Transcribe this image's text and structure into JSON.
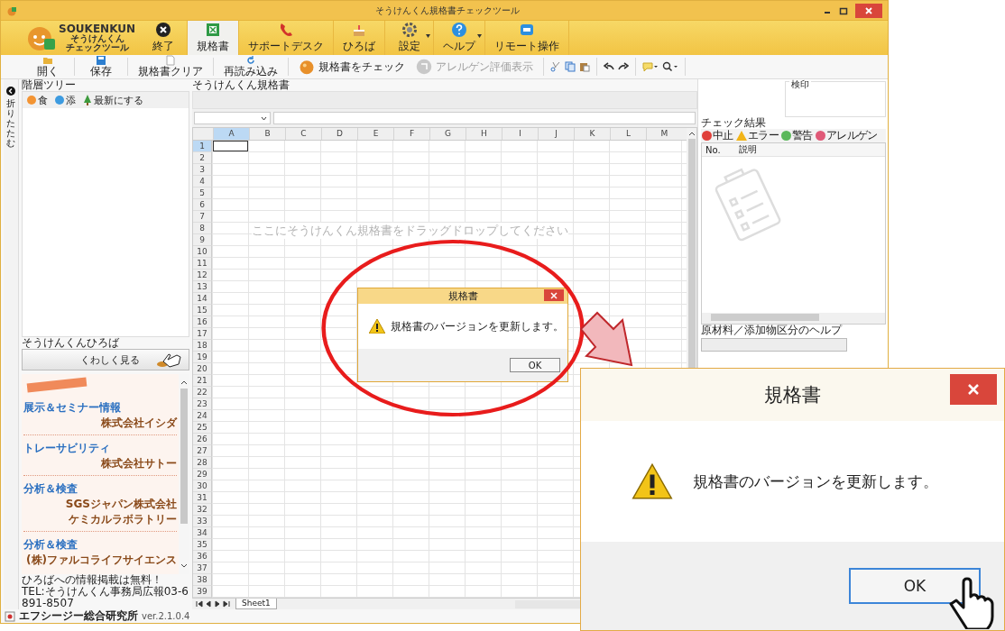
{
  "window": {
    "title": "そうけんくん規格書チェックツール"
  },
  "logo": {
    "name": "SOUKENKUN",
    "subtitle": "そうけんくん",
    "tagline": "チェックツール"
  },
  "ribbon_tabs": [
    {
      "label": "終了",
      "selected": false,
      "dropdown": false
    },
    {
      "label": "規格書",
      "selected": true,
      "dropdown": false
    },
    {
      "label": "サポートデスク",
      "selected": false,
      "dropdown": false
    },
    {
      "label": "ひろば",
      "selected": false,
      "dropdown": false
    },
    {
      "label": "設定",
      "selected": false,
      "dropdown": true
    },
    {
      "label": "ヘルプ",
      "selected": false,
      "dropdown": true
    },
    {
      "label": "リモート操作",
      "selected": false,
      "dropdown": false
    }
  ],
  "toolbar": [
    {
      "label": "開く",
      "kind": "stacked",
      "disabled": false
    },
    {
      "label": "保存",
      "kind": "stacked",
      "disabled": false
    },
    {
      "label": "規格書クリア",
      "kind": "stacked",
      "disabled": false
    },
    {
      "label": "再読み込み",
      "kind": "stacked",
      "disabled": false
    },
    {
      "label": "規格書をチェック",
      "kind": "inline",
      "disabled": false
    },
    {
      "label": "アレルゲン評価表示",
      "kind": "inline",
      "disabled": true
    }
  ],
  "left_panel": {
    "collapse_label": "折りたたむ",
    "title": "階層ツリー",
    "filters": [
      {
        "label": "食",
        "color": "#f39433"
      },
      {
        "label": "添",
        "color": "#3d9be0"
      }
    ],
    "refresh_label": "最新にする"
  },
  "hiroba": {
    "title": "そうけんくんひろば",
    "more_button": "くわしく見る",
    "entries": [
      {
        "category": "展示＆セミナー情報",
        "company": [
          "株式会社イシダ"
        ]
      },
      {
        "category": "トレーサビリティ",
        "company": [
          "株式会社サトー"
        ]
      },
      {
        "category": "分析＆検査",
        "company": [
          "SGSジャパン株式会社",
          "ケミカルラボラトリー"
        ]
      },
      {
        "category": "分析＆検査",
        "company": [
          "(株)ファルコライフサイエンス"
        ]
      }
    ],
    "footer": [
      "ひろばへの情報掲載は無料！",
      "TEL:そうけんくん事務局広報03-6891-8507"
    ]
  },
  "editor": {
    "title": "そうけんくん規格書",
    "columns": [
      {
        "label": "A",
        "selected": true
      },
      {
        "label": "B",
        "selected": false
      },
      {
        "label": "C",
        "selected": false
      },
      {
        "label": "D",
        "selected": false
      },
      {
        "label": "E",
        "selected": false
      },
      {
        "label": "F",
        "selected": false
      },
      {
        "label": "G",
        "selected": false
      },
      {
        "label": "H",
        "selected": false
      },
      {
        "label": "I",
        "selected": false
      },
      {
        "label": "J",
        "selected": false
      },
      {
        "label": "K",
        "selected": false
      },
      {
        "label": "L",
        "selected": false
      },
      {
        "label": "M",
        "selected": false
      }
    ],
    "rows": [
      {
        "label": "1",
        "selected": true
      },
      {
        "label": "2",
        "selected": false
      },
      {
        "label": "3",
        "selected": false
      },
      {
        "label": "4",
        "selected": false
      },
      {
        "label": "5",
        "selected": false
      },
      {
        "label": "6",
        "selected": false
      },
      {
        "label": "7",
        "selected": false
      },
      {
        "label": "8",
        "selected": false
      },
      {
        "label": "9",
        "selected": false
      },
      {
        "label": "10",
        "selected": false
      },
      {
        "label": "11",
        "selected": false
      },
      {
        "label": "12",
        "selected": false
      },
      {
        "label": "13",
        "selected": false
      },
      {
        "label": "14",
        "selected": false
      },
      {
        "label": "15",
        "selected": false
      },
      {
        "label": "16",
        "selected": false
      },
      {
        "label": "17",
        "selected": false
      },
      {
        "label": "18",
        "selected": false
      },
      {
        "label": "19",
        "selected": false
      },
      {
        "label": "20",
        "selected": false
      },
      {
        "label": "21",
        "selected": false
      },
      {
        "label": "22",
        "selected": false
      },
      {
        "label": "23",
        "selected": false
      },
      {
        "label": "24",
        "selected": false
      },
      {
        "label": "25",
        "selected": false
      },
      {
        "label": "26",
        "selected": false
      },
      {
        "label": "27",
        "selected": false
      },
      {
        "label": "28",
        "selected": false
      },
      {
        "label": "29",
        "selected": false
      },
      {
        "label": "30",
        "selected": false
      },
      {
        "label": "31",
        "selected": false
      },
      {
        "label": "32",
        "selected": false
      },
      {
        "label": "33",
        "selected": false
      },
      {
        "label": "34",
        "selected": false
      },
      {
        "label": "35",
        "selected": false
      },
      {
        "label": "36",
        "selected": false
      },
      {
        "label": "37",
        "selected": false
      },
      {
        "label": "38",
        "selected": false
      },
      {
        "label": "39",
        "selected": false
      }
    ],
    "drop_hint": "ここにそうけんくん規格書をドラッグドロップしてください",
    "sheet_tabs": [
      {
        "label": "Sheet1",
        "selected": true
      }
    ]
  },
  "right_panel": {
    "stamp_title": "検印",
    "results_title": "チェック結果",
    "result_filters": [
      {
        "label": "中止",
        "kind": "circle",
        "color": "#e0403a"
      },
      {
        "label": "エラー",
        "kind": "triangle",
        "color": "#f2b418"
      },
      {
        "label": "警告",
        "kind": "circle",
        "color": "#5cb85c"
      },
      {
        "label": "アレルゲン",
        "kind": "circle",
        "color": "#e05a78"
      }
    ],
    "result_columns": [
      "No.",
      "説明"
    ],
    "help_title": "原材料／添加物区分のヘルプ"
  },
  "dialog": {
    "title": "規格書",
    "message": "規格書のバージョンを更新します。",
    "ok": "OK"
  },
  "zoomed_dialog": {
    "title": "規格書",
    "message": "規格書のバージョンを更新します。",
    "ok": "OK"
  },
  "status_bar": {
    "company": "エフシージー総合研究所",
    "version": "ver.2.1.0.4"
  }
}
